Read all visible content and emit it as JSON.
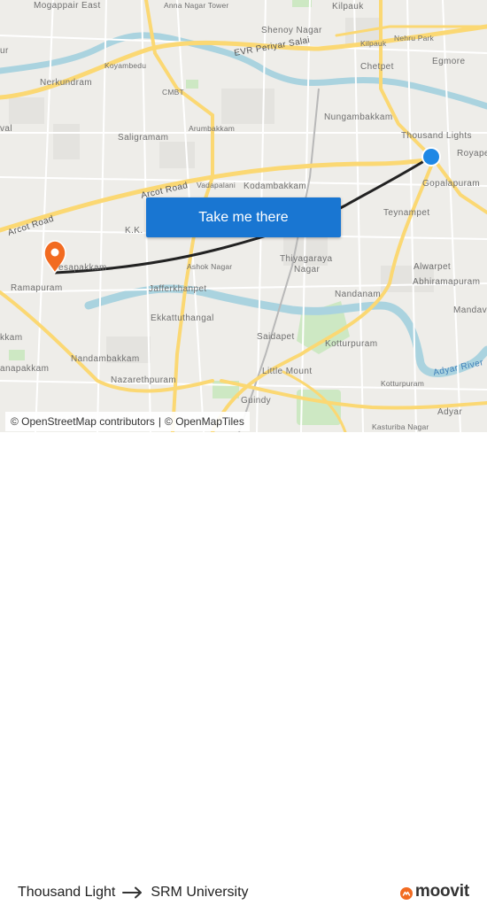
{
  "map": {
    "labels": {
      "mogappair_east": "Mogappair East",
      "anna_nagar_tower": "Anna Nagar Tower",
      "kilpauk_top": "Kilpauk",
      "shenoy_nagar": "Shenoy Nagar",
      "evr_periyar_salai": "EVR Periyar Salai",
      "kilpauk_small": "Kilpauk",
      "nehru_park": "Nehru Park",
      "egmore": "Egmore",
      "koyambedu": "Koyambedu",
      "chetpet": "Chetpet",
      "nerkundram": "Nerkundram",
      "cmbt": "CMBT",
      "nungambakkam": "Nungambakkam",
      "saligramam": "Saligramam",
      "arumbakkam": "Arumbakkam",
      "thousand_lights": "Thousand Lights",
      "royapettah": "Royape",
      "arcot_road_1": "Arcot Road",
      "vadapalani": "Vadapalani",
      "kodambakkam": "Kodambakkam",
      "gopalapuram": "Gopalapuram",
      "teynampet": "Teynampet",
      "arcot_road_2": "Arcot Road",
      "kk_nagar": "K.K.",
      "thiyagaraya_nagar_1": "Thiyagaraya",
      "thiyagaraya_nagar_2": "Nagar",
      "virugambakkam": "esapakkam",
      "ashok_nagar": "Ashok Nagar",
      "alwarpet": "Alwarpet",
      "ramapuram": "Ramapuram",
      "jafferkhanpet": "Jafferkhanpet",
      "abhiramapuram": "Abhiramapuram",
      "nandanam": "Nandanam",
      "mandaveli": "Mandav",
      "ekkattuthangal": "Ekkattuthangal",
      "saidapet": "Saidapet",
      "kotturpuram_1": "Kotturpuram",
      "kk_left": "kkam",
      "nandambakkam": "Nandambakkam",
      "little_mount": "Little Mount",
      "adyar_river": "Adyar River",
      "manapakkam": "anapakkam",
      "nazarethpuram": "Nazarethpuram",
      "kotturpuram_2": "Kotturpuram",
      "guindy": "Guindy",
      "adyar": "Adyar",
      "kasturiba_nagar": "Kasturiba Nagar",
      "ur": "ur",
      "val": "val"
    },
    "origin_name": "Thousand Lights",
    "destination_name": "SRM University",
    "colors": {
      "route": "#222222",
      "origin_dot": "#1e88e5",
      "destination_pin": "#f26b21",
      "water": "#aad3df",
      "major_road": "#fcd96a",
      "button": "#1976d2"
    }
  },
  "cta": {
    "label": "Take me there"
  },
  "attribution": {
    "osm": "© OpenStreetMap contributors",
    "separator": "|",
    "omt": "© OpenMapTiles"
  },
  "footer": {
    "origin": "Thousand Light",
    "destination": "SRM University",
    "brand": "moovit",
    "arrow_icon": "right-arrow-icon",
    "brand_icon": "moovit-logo-icon"
  }
}
